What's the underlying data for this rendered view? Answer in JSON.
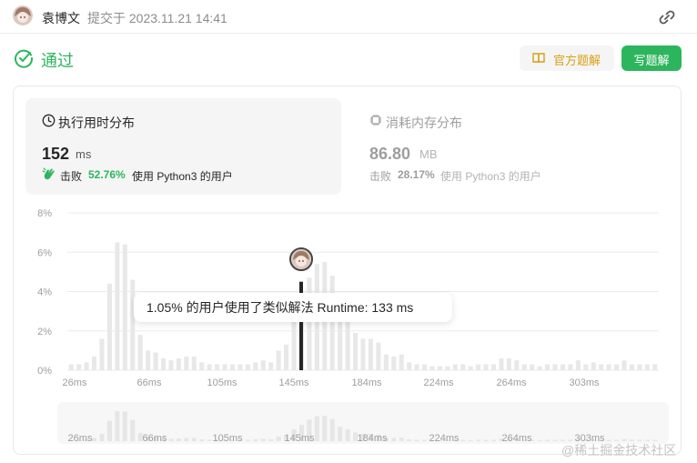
{
  "header": {
    "author": "袁博文",
    "submit_time": "提交于 2023.11.21 14:41",
    "link_icon": "link-icon"
  },
  "status": {
    "text": "通过",
    "icon": "check-circle-icon",
    "color": "#2db55d"
  },
  "buttons": {
    "official_solution": "官方题解",
    "write_solution": "写题解"
  },
  "runtime": {
    "title": "执行用时分布",
    "value": "152",
    "unit": "ms",
    "beat_label": "击败",
    "beat_percent": "52.76%",
    "beat_rest": "使用 Python3 的用户"
  },
  "memory": {
    "title": "消耗内存分布",
    "value": "86.80",
    "unit": "MB",
    "beat_label": "击败",
    "beat_percent": "28.17%",
    "beat_rest": "使用 Python3 的用户"
  },
  "tooltip": {
    "text": "1.05% 的用户使用了类似解法 Runtime: 133 ms"
  },
  "watermark": "@稀土掘金技术社区",
  "chart_data": {
    "type": "bar",
    "ylim": [
      0,
      8
    ],
    "y_ticks": [
      "0%",
      "2%",
      "4%",
      "6%",
      "8%"
    ],
    "x_ticks": [
      "26ms",
      "66ms",
      "105ms",
      "145ms",
      "184ms",
      "224ms",
      "264ms",
      "303ms"
    ],
    "values": [
      0.3,
      0.3,
      0.4,
      0.7,
      1.6,
      4.4,
      6.5,
      6.4,
      4.6,
      1.8,
      1.0,
      0.9,
      0.6,
      0.5,
      0.6,
      0.7,
      0.7,
      0.4,
      0.3,
      0.3,
      0.3,
      0.3,
      0.3,
      0.3,
      0.4,
      0.5,
      0.4,
      1.0,
      1.3,
      2.6,
      3.5,
      4.7,
      5.4,
      5.5,
      4.8,
      3.1,
      2.6,
      1.9,
      1.6,
      1.6,
      1.4,
      0.8,
      0.7,
      0.8,
      0.4,
      0.3,
      0.3,
      0.2,
      0.2,
      0.2,
      0.3,
      0.3,
      0.2,
      0.3,
      0.3,
      0.3,
      0.6,
      0.6,
      0.5,
      0.3,
      0.3,
      0.2,
      0.3,
      0.3,
      0.3,
      0.3,
      0.5,
      0.3,
      0.4,
      0.3,
      0.3,
      0.3,
      0.5,
      0.3,
      0.3,
      0.3,
      0.3
    ],
    "highlight": {
      "label": "Runtime: 133 ms",
      "percent": 1.05,
      "value": 4.5
    },
    "colors": {
      "bars": "#e8e8e8",
      "highlight": "#262626",
      "grid": "#ebebeb"
    }
  }
}
